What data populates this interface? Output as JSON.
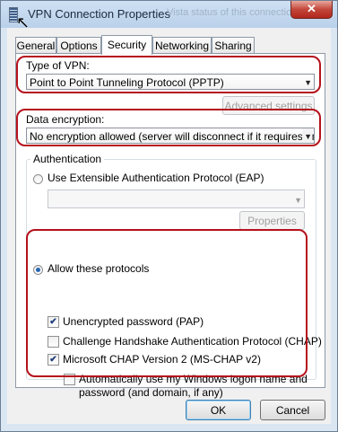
{
  "window": {
    "title": "VPN Connection Properties",
    "faded_background_text": "Vista status of this connection",
    "close_glyph": "✕"
  },
  "tabs": [
    {
      "label": "General",
      "active": false
    },
    {
      "label": "Options",
      "active": false
    },
    {
      "label": "Security",
      "active": true
    },
    {
      "label": "Networking",
      "active": false
    },
    {
      "label": "Sharing",
      "active": false
    }
  ],
  "security": {
    "vpn_type_label": "Type of VPN:",
    "vpn_type_value": "Point to Point Tunneling Protocol (PPTP)",
    "advanced_settings_label": "Advanced settings",
    "encryption_label": "Data encryption:",
    "encryption_value": "No encryption allowed (server will disconnect if it requires encry",
    "authentication": {
      "group_label": "Authentication",
      "eap_label": "Use Extensible Authentication Protocol (EAP)",
      "eap_selected": false,
      "eap_method_value": "",
      "properties_label": "Properties",
      "allow_protocols_label": "Allow these protocols",
      "allow_protocols_selected": true,
      "protocols": {
        "pap": {
          "label": "Unencrypted password (PAP)",
          "checked": true
        },
        "chap": {
          "label": "Challenge Handshake Authentication Protocol (CHAP)",
          "checked": false
        },
        "mschapv2": {
          "label": "Microsoft CHAP Version 2 (MS-CHAP v2)",
          "checked": true
        },
        "auto_logon_line1": "Automatically use my Windows logon name and",
        "auto_logon_line2": "password (and domain, if any)",
        "auto_logon_checked": false
      }
    }
  },
  "footer": {
    "ok_label": "OK",
    "cancel_label": "Cancel"
  },
  "colors": {
    "highlight": "#b5121b",
    "close_button": "#c3463a"
  },
  "icons": {
    "app_icon": "vpn-connection-icon",
    "close_icon": "close-icon",
    "dropdown_icon": "chevron-down-icon",
    "check_glyph": "✔",
    "dropdown_glyph": "▼",
    "cursor_glyph": "↖"
  }
}
